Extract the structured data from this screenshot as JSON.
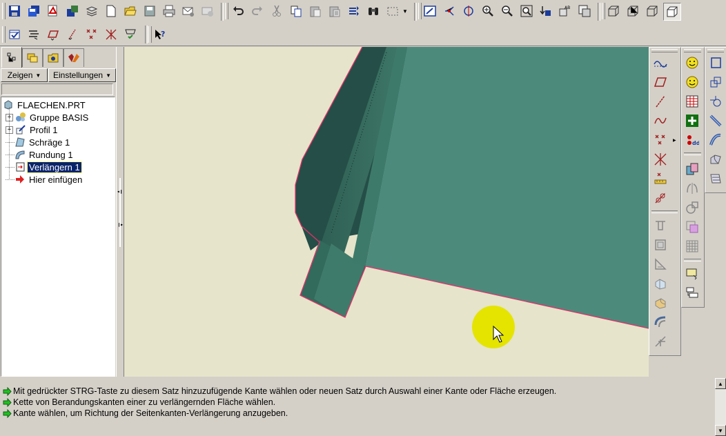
{
  "toolbar_top": {
    "icons": [
      "save-icon",
      "save-copy-icon",
      "pdf-icon",
      "backup-icon",
      "layers-icon",
      "new-icon",
      "open-icon",
      "save-file-icon",
      "print-icon",
      "mail-icon",
      "mail-gray-icon",
      "undo-icon",
      "redo-icon",
      "cut-icon",
      "copy-icon",
      "paste-icon",
      "paste-special-icon",
      "regenerate-icon",
      "find-icon",
      "select-box-icon",
      "repaint-icon",
      "spin-center-icon",
      "orient-icon",
      "zoom-in-icon",
      "zoom-out-icon",
      "refit-icon",
      "named-view-icon",
      "view-manager-icon",
      "saved-views-icon",
      "wireframe-icon",
      "hidden-line-icon",
      "no-hidden-icon",
      "shading-icon"
    ]
  },
  "toolbar_second": {
    "icons": [
      "datum-planes-icon",
      "datum-axes-icon",
      "datum-points-icon",
      "datum-csys-icon",
      "datum-curves-icon",
      "datum-display-icon",
      "whats-this-icon"
    ]
  },
  "left_panel": {
    "tabs": [
      "model-tree-icon",
      "layer-tree-icon",
      "folder-browser-icon",
      "favorites-icon"
    ],
    "show_button": "Zeigen",
    "settings_button": "Einstellungen",
    "tree": [
      {
        "label": "FLAECHEN.PRT",
        "icon": "part-icon",
        "expander": "",
        "indent": 0
      },
      {
        "label": "Gruppe BASIS",
        "icon": "group-icon",
        "expander": "+",
        "indent": 1
      },
      {
        "label": "Profil 1",
        "icon": "sketch-icon",
        "expander": "+",
        "indent": 1
      },
      {
        "label": "Schräge 1",
        "icon": "draft-icon",
        "expander": "",
        "indent": 1
      },
      {
        "label": "Rundung 1",
        "icon": "round-icon",
        "expander": "",
        "indent": 1
      },
      {
        "label": "Verlängern 1",
        "icon": "extend-icon",
        "expander": "",
        "indent": 1,
        "selected": true
      },
      {
        "label": "Hier einfügen",
        "icon": "insert-here-icon",
        "expander": "",
        "indent": 1
      }
    ]
  },
  "colors": {
    "background": "#e6e4ca",
    "surface_dark": "#244e47",
    "surface_main": "#4c8a7c",
    "edge_highlight": "#e0306a",
    "cursor_highlight": "#e4e400"
  },
  "messages": [
    "Mit gedrückter STRG-Taste zu diesem Satz hinzuzufügende Kante wählen oder neuen Satz durch Auswahl einer Kante oder Fläche erzeugen.",
    "Kette von Berandungskanten einer zu verlängernden Fläche wählen.",
    "Kante wählen, um Richtung der Seitenkanten-Verlängerung anzugeben."
  ],
  "right_toolbar_1": [
    "sketched-curve-icon",
    "datum-plane-icon",
    "datum-axis-icon",
    "datum-curve-icon",
    "datum-point-icon",
    "coordinate-system-icon",
    "analysis-icon",
    "relations-icon",
    "hole-icon",
    "shell-icon",
    "rib-icon",
    "draft-feature-icon",
    "round-feature-icon",
    "chamfer-icon",
    "cosmetic-icon"
  ],
  "right_toolbar_2": [
    "smiley-icon",
    "smiley-2-icon",
    "table-icon",
    "add-icon",
    "family-table-icon",
    "extrude-surface-icon",
    "mirror-icon",
    "revolve-icon",
    "merge-icon",
    "pattern-icon",
    "layer-select-icon",
    "layer-list-icon"
  ],
  "right_toolbar_3": [
    "extrude-icon",
    "revolve-tool-icon",
    "variable-sweep-icon",
    "blend-icon",
    "boundary-blend-icon",
    "style-icon",
    "warp-icon"
  ]
}
